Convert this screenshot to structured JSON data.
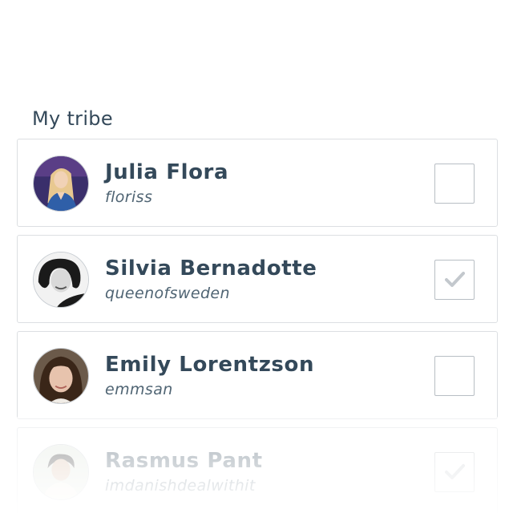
{
  "section": {
    "title": "My tribe"
  },
  "members": [
    {
      "name": "Julia Flora",
      "handle": "floriss",
      "checked": false,
      "avatar_icon": "avatar-julia-flora",
      "avatar_bg": "#3a2f6b",
      "avatar_accent": "#e8c890"
    },
    {
      "name": "Silvia Bernadotte",
      "handle": "queenofsweden",
      "checked": true,
      "avatar_icon": "avatar-silvia-bernadotte",
      "avatar_bg": "#f2f2f2",
      "avatar_accent": "#1a1a1a"
    },
    {
      "name": "Emily Lorentzson",
      "handle": "emmsan",
      "checked": false,
      "avatar_icon": "avatar-emily-lorentzson",
      "avatar_bg": "#6b5a4a",
      "avatar_accent": "#3a2618"
    },
    {
      "name": "Rasmus Pant",
      "handle": "imdanishdealwithit",
      "checked": true,
      "avatar_icon": "avatar-rasmus-pant",
      "avatar_bg": "#dfe6dc",
      "avatar_accent": "#2a2a2a"
    }
  ],
  "colors": {
    "text_primary": "#34495a",
    "text_secondary": "#4f6473",
    "card_border": "#dcdfe2",
    "checkbox_border": "#b8bec4",
    "checkmark": "#c3c8cd"
  }
}
